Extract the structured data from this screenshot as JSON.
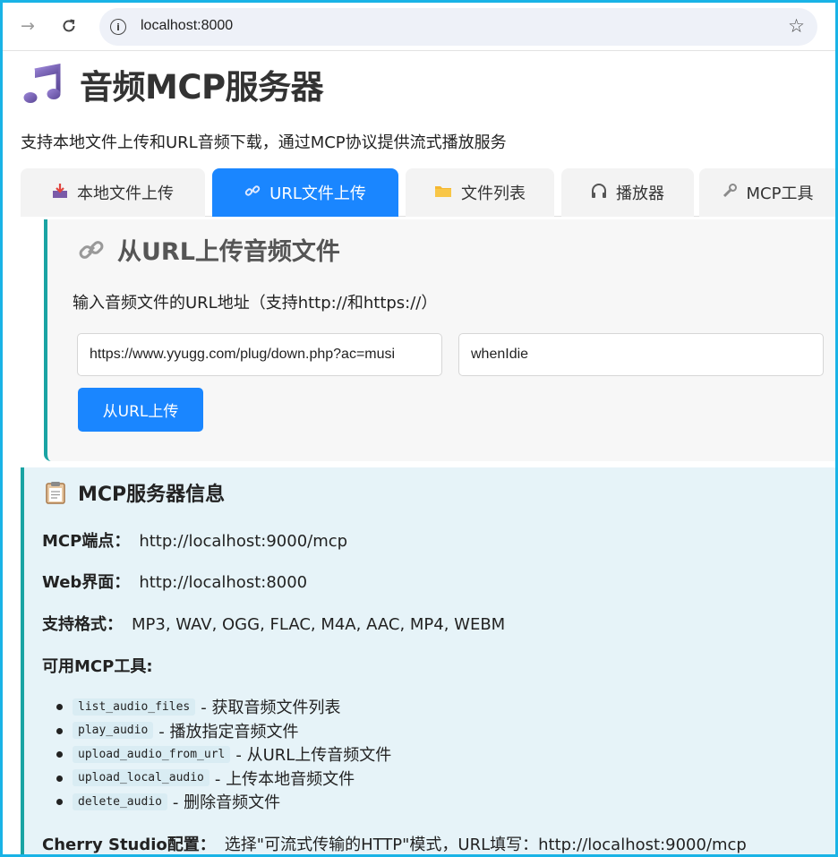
{
  "browser": {
    "url": "localhost:8000",
    "back_icon": "arrow-right-icon",
    "reload_icon": "reload-icon",
    "bookmark_icon": "star-icon"
  },
  "header": {
    "title": "音频MCP服务器",
    "subtitle": "支持本地文件上传和URL音频下载，通过MCP协议提供流式播放服务"
  },
  "tabs": [
    {
      "label": "本地文件上传",
      "icon": "inbox-tray-icon",
      "active": false
    },
    {
      "label": "URL文件上传",
      "icon": "link-icon",
      "active": true
    },
    {
      "label": "文件列表",
      "icon": "folder-icon",
      "active": false
    },
    {
      "label": "播放器",
      "icon": "headphones-icon",
      "active": false
    },
    {
      "label": "MCP工具",
      "icon": "wrench-icon",
      "active": false
    }
  ],
  "url_upload": {
    "heading": "从URL上传音频文件",
    "description": "输入音频文件的URL地址（支持http://和https://）",
    "url_value": "https://www.yyugg.com/plug/down.php?ac=musi",
    "name_value": "whenIdie",
    "button_label": "从URL上传"
  },
  "server_info": {
    "heading": "MCP服务器信息",
    "endpoint_label": "MCP端点：",
    "endpoint_value": "http://localhost:9000/mcp",
    "web_label": "Web界面：",
    "web_value": "http://localhost:8000",
    "formats_label": "支持格式：",
    "formats_value": "MP3, WAV, OGG, FLAC, M4A, AAC, MP4, WEBM",
    "tools_label": "可用MCP工具:",
    "tools": [
      {
        "name": "list_audio_files",
        "desc": "- 获取音频文件列表"
      },
      {
        "name": "play_audio",
        "desc": "- 播放指定音频文件"
      },
      {
        "name": "upload_audio_from_url",
        "desc": "- 从URL上传音频文件"
      },
      {
        "name": "upload_local_audio",
        "desc": "- 上传本地音频文件"
      },
      {
        "name": "delete_audio",
        "desc": "- 删除音频文件"
      }
    ],
    "cherry_label": "Cherry Studio配置：",
    "cherry_value": "选择\"可流式传输的HTTP\"模式，URL填写：http://localhost:9000/mcp"
  },
  "colors": {
    "accent": "#1a86ff",
    "panel_border": "#1aa3a3",
    "info_bg": "#e6f3f8",
    "frame_border": "#19b3e6"
  }
}
